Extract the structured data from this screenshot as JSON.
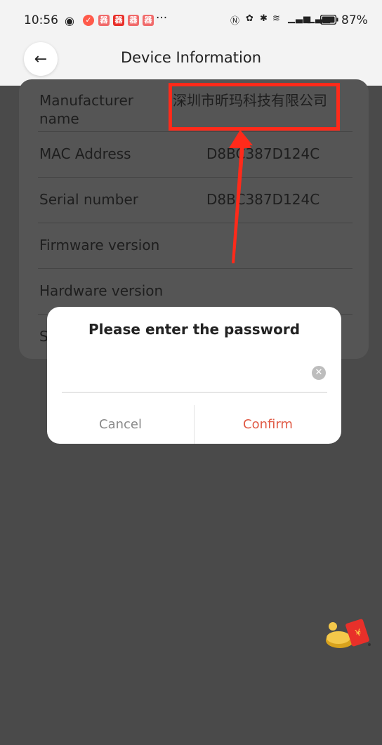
{
  "status_bar": {
    "time": "10:56",
    "more": "···",
    "battery_percent": "87%"
  },
  "header": {
    "title": "Device Information"
  },
  "rows": [
    {
      "label": "Manufacturer name",
      "value": "深圳市昕玛科技有限公司"
    },
    {
      "label": "MAC Address",
      "value": "D8BC387D124C"
    },
    {
      "label": "Serial number",
      "value": "D8BC387D124C"
    },
    {
      "label": "Firmware version",
      "value": ""
    },
    {
      "label": "Hardware version",
      "value": ""
    },
    {
      "label": "S",
      "value": ""
    }
  ],
  "dialog": {
    "title": "Please enter the password",
    "password_value": "",
    "cancel_label": "Cancel",
    "confirm_label": "Confirm"
  },
  "colors": {
    "accent": "#e05a45",
    "annotation": "#ff2a1a"
  },
  "icons": {
    "back": "arrow-left-icon",
    "clear": "clear-circle-icon"
  }
}
